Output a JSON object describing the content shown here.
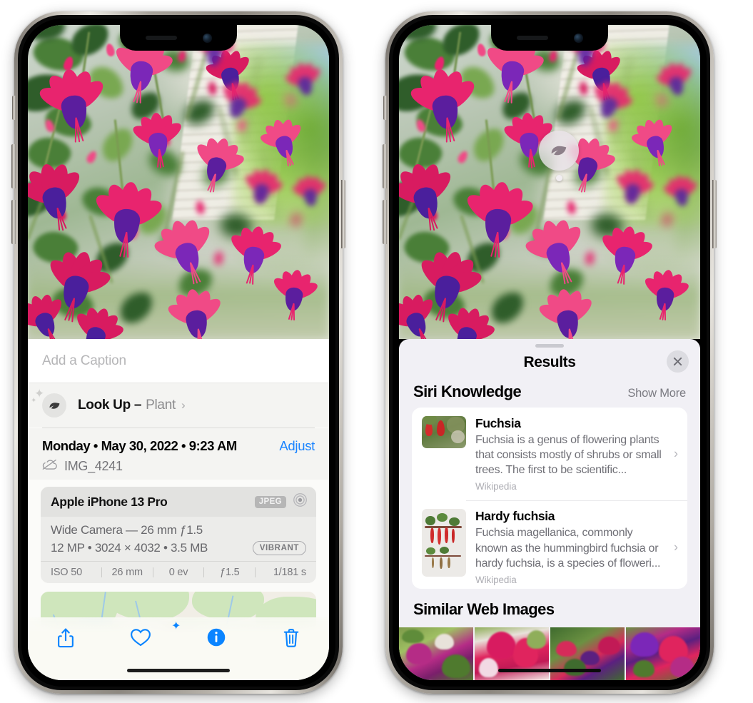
{
  "left_phone": {
    "photo": {
      "alt": "Fuchsia flowers hanging from a porch basket"
    },
    "caption": {
      "placeholder": "Add a Caption",
      "value": ""
    },
    "lookup": {
      "icon": "leaf-icon",
      "label": "Look Up –",
      "subject": "Plant",
      "chevron": "›"
    },
    "date": {
      "text": "Monday • May 30, 2022 • 9:23 AM",
      "adjust_label": "Adjust"
    },
    "file": {
      "icon": "cloud-slash-icon",
      "name": "IMG_4241"
    },
    "exif": {
      "device": "Apple iPhone 13 Pro",
      "format_badge": "JPEG",
      "lens_icon": "aperture-icon",
      "lens_line": "Wide Camera — 26 mm ƒ1.5",
      "specs_line": "12 MP • 3024 × 4032 • 3.5 MB",
      "style_badge": "VIBRANT",
      "stats": [
        "ISO 50",
        "26 mm",
        "0 ev",
        "ƒ1.5",
        "1/181 s"
      ]
    },
    "map": {
      "alt": "Map preview with photo location pin"
    },
    "toolbar": [
      {
        "name": "share-button",
        "icon": "share-icon"
      },
      {
        "name": "favorite-button",
        "icon": "heart-icon"
      },
      {
        "name": "info-button",
        "icon": "info-circle-icon"
      },
      {
        "name": "delete-button",
        "icon": "trash-icon"
      }
    ],
    "colors": {
      "accent": "#1a84ff",
      "sheet_bg": "#f4f4f2"
    }
  },
  "right_phone": {
    "photo": {
      "alt": "Fuchsia flowers with Visual Look Up badge"
    },
    "vlu_badge": {
      "icon": "leaf-icon",
      "label": "Visual Look Up"
    },
    "results": {
      "title": "Results",
      "close_icon": "close-icon",
      "siri_knowledge": {
        "heading": "Siri Knowledge",
        "show_more": "Show More",
        "items": [
          {
            "title": "Fuchsia",
            "snippet": "Fuchsia is a genus of flowering plants that consists mostly of shrubs or small trees. The first to be scientific...",
            "source": "Wikipedia",
            "chevron": "›"
          },
          {
            "title": "Hardy fuchsia",
            "snippet": "Fuchsia magellanica, commonly known as the hummingbird fuchsia or hardy fuchsia, is a species of floweri...",
            "source": "Wikipedia",
            "chevron": "›"
          }
        ]
      },
      "similar_web_images": {
        "heading": "Similar Web Images",
        "count": 4
      }
    },
    "colors": {
      "panel_bg": "#f1f0f5",
      "card_bg": "#ffffff"
    }
  }
}
